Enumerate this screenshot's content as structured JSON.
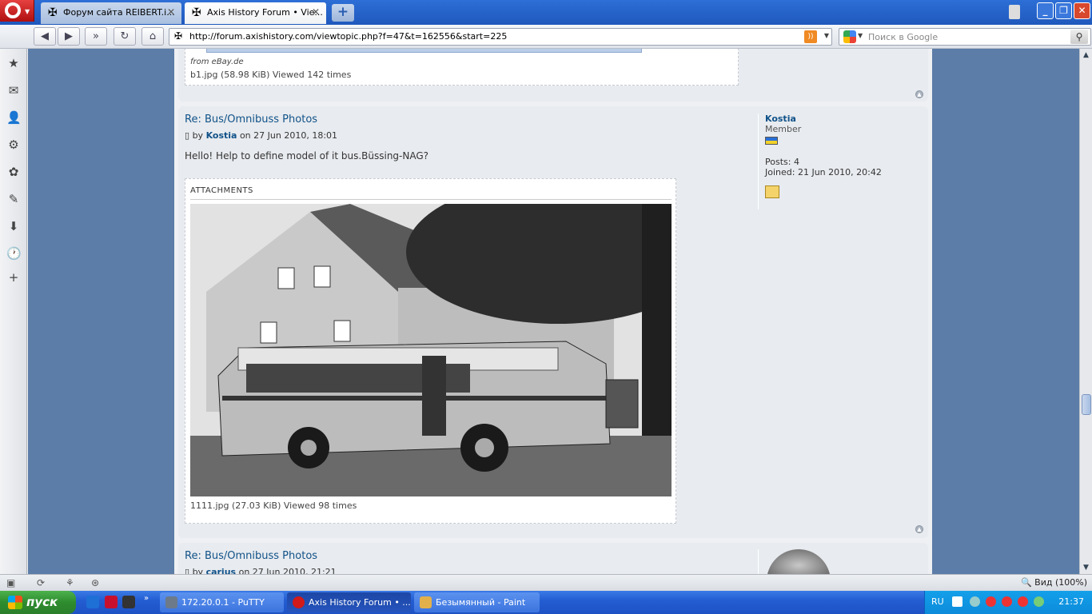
{
  "browser": {
    "tabs": [
      {
        "label": "Форум сайта REIBERT.i..."
      },
      {
        "label": "Axis History Forum • Vie..."
      }
    ],
    "address": "http://forum.axishistory.com/viewtopic.php?f=47&t=162556&start=225",
    "search_placeholder": "Поиск в Google",
    "zoom_label": "Вид (100%)"
  },
  "prev_attachment": {
    "source_text": "from eBay.de",
    "caption": "b1.jpg (58.98 KiB) Viewed 142 times"
  },
  "post1": {
    "title": "Re: Bus/Omnibuss Photos",
    "by_prefix": "by",
    "author": "Kostia",
    "date": "on 27 Jun 2010, 18:01",
    "body": "Hello! Help to define model of it bus.Büssing-NAG?",
    "attachments_label": "ATTACHMENTS",
    "attachment_caption": "1111.jpg (27.03 KiB) Viewed 98 times",
    "profile": {
      "username": "Kostia",
      "rank": "Member",
      "posts_label": "Posts:",
      "posts_value": "4",
      "joined_label": "Joined:",
      "joined_value": "21 Jun 2010, 20:42"
    }
  },
  "post2": {
    "title": "Re: Bus/Omnibuss Photos",
    "by_prefix": "by",
    "author": "carius",
    "date": "on 27 Jun 2010, 21:21"
  },
  "taskbar": {
    "start_label": "пуск",
    "tasks": [
      {
        "label": "172.20.0.1 - PuTTY"
      },
      {
        "label": "Axis History Forum • ..."
      },
      {
        "label": "Безымянный - Paint"
      }
    ],
    "language": "RU",
    "clock": "21:37"
  }
}
